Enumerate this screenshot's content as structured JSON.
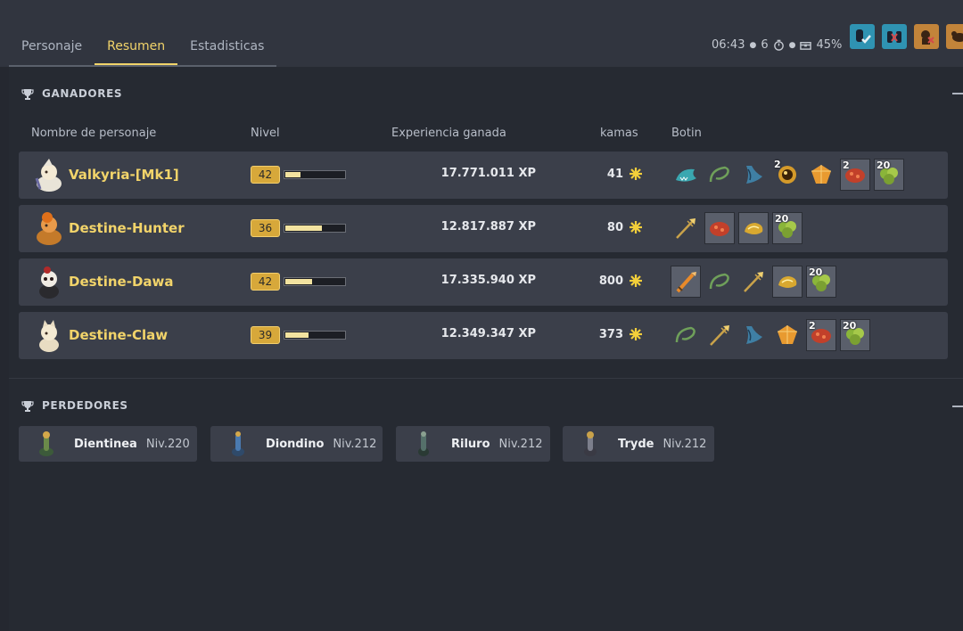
{
  "tabs": [
    {
      "label": "Personaje"
    },
    {
      "label": "Resumen"
    },
    {
      "label": "Estadisticas"
    }
  ],
  "status": {
    "time": "06:43",
    "turns": "6",
    "percent": "45%"
  },
  "winners": {
    "title": "GANADORES",
    "columns": {
      "name": "Nombre de personaje",
      "level": "Nivel",
      "xp": "Experiencia ganada",
      "kamas": "kamas",
      "loot": "Botin"
    },
    "xp_unit": "XP",
    "rows": [
      {
        "name": "Valkyria-[Mk1]",
        "level": "42",
        "level_progress": 0.25,
        "xp": "17.771.011",
        "kamas": "41",
        "loot": [
          {
            "icon": "shark-head-icon",
            "boxed": false,
            "qty": ""
          },
          {
            "icon": "green-whip-icon",
            "boxed": false,
            "qty": ""
          },
          {
            "icon": "blue-claw-icon",
            "boxed": false,
            "qty": ""
          },
          {
            "icon": "golden-orb-icon",
            "boxed": false,
            "qty": "2"
          },
          {
            "icon": "orange-gem-icon",
            "boxed": false,
            "qty": ""
          },
          {
            "icon": "red-meat-icon",
            "boxed": true,
            "qty": "2"
          },
          {
            "icon": "green-herb-icon",
            "boxed": true,
            "qty": "20"
          }
        ]
      },
      {
        "name": "Destine-Hunter",
        "level": "36",
        "level_progress": 0.62,
        "xp": "12.817.887",
        "kamas": "80",
        "loot": [
          {
            "icon": "golden-spear-icon",
            "boxed": false,
            "qty": ""
          },
          {
            "icon": "red-meat-icon",
            "boxed": true,
            "qty": ""
          },
          {
            "icon": "gold-nugget-icon",
            "boxed": true,
            "qty": ""
          },
          {
            "icon": "green-herb-icon",
            "boxed": true,
            "qty": "20"
          }
        ]
      },
      {
        "name": "Destine-Dawa",
        "level": "42",
        "level_progress": 0.45,
        "xp": "17.335.940",
        "kamas": "800",
        "loot": [
          {
            "icon": "orange-sword-icon",
            "boxed": true,
            "qty": ""
          },
          {
            "icon": "green-whip-icon",
            "boxed": false,
            "qty": ""
          },
          {
            "icon": "golden-spear-icon",
            "boxed": false,
            "qty": ""
          },
          {
            "icon": "gold-nugget-icon",
            "boxed": true,
            "qty": ""
          },
          {
            "icon": "green-herb-icon",
            "boxed": true,
            "qty": "20"
          }
        ]
      },
      {
        "name": "Destine-Claw",
        "level": "39",
        "level_progress": 0.4,
        "xp": "12.349.347",
        "kamas": "373",
        "loot": [
          {
            "icon": "green-whip-icon",
            "boxed": false,
            "qty": ""
          },
          {
            "icon": "golden-spear-icon",
            "boxed": false,
            "qty": ""
          },
          {
            "icon": "blue-claw-icon",
            "boxed": false,
            "qty": ""
          },
          {
            "icon": "orange-gem-icon",
            "boxed": false,
            "qty": ""
          },
          {
            "icon": "red-meat-icon",
            "boxed": true,
            "qty": "2"
          },
          {
            "icon": "green-herb-icon",
            "boxed": true,
            "qty": "20"
          }
        ]
      }
    ]
  },
  "losers": {
    "title": "PERDEDORES",
    "items": [
      {
        "name": "Dientinea",
        "level": "Niv.220"
      },
      {
        "name": "Diondino",
        "level": "Niv.212"
      },
      {
        "name": "Riluro",
        "level": "Niv.212"
      },
      {
        "name": "Tryde",
        "level": "Niv.212"
      }
    ]
  },
  "colors": {
    "accent": "#f2d46a",
    "row_bg": "#3b3f4a",
    "background": "#252830",
    "kama": "#f3cf3a"
  }
}
